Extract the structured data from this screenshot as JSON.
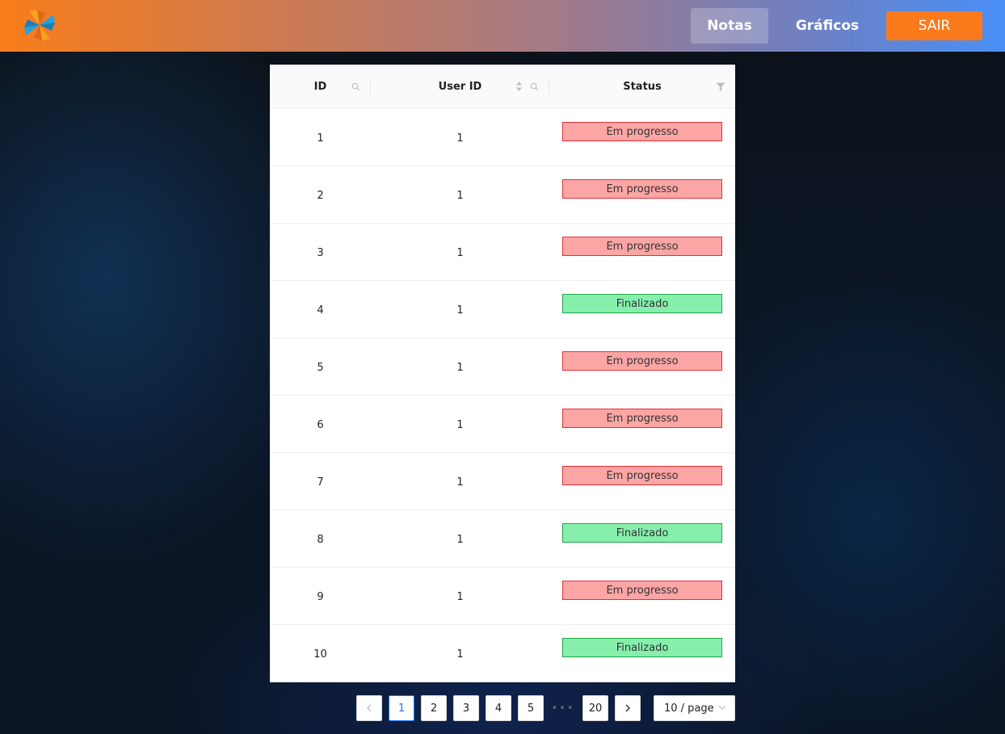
{
  "header": {
    "logo_icon": "pinwheel-logo-icon",
    "nav": {
      "notas": "Notas",
      "graficos": "Gráficos",
      "sair": "SAIR"
    },
    "colors": {
      "gradient_start": "#f97d1a",
      "gradient_end": "#4a8ff5",
      "sair_bg": "#fa7a1c"
    }
  },
  "table": {
    "columns": {
      "id": "ID",
      "user_id": "User ID",
      "status": "Status"
    },
    "column_icons": {
      "id": "search-icon",
      "user_id": [
        "sort-icon",
        "search-icon"
      ],
      "status": "filter-icon"
    },
    "rows": [
      {
        "id": "1",
        "user_id": "1",
        "status": "Em progresso"
      },
      {
        "id": "2",
        "user_id": "1",
        "status": "Em progresso"
      },
      {
        "id": "3",
        "user_id": "1",
        "status": "Em progresso"
      },
      {
        "id": "4",
        "user_id": "1",
        "status": "Finalizado"
      },
      {
        "id": "5",
        "user_id": "1",
        "status": "Em progresso"
      },
      {
        "id": "6",
        "user_id": "1",
        "status": "Em progresso"
      },
      {
        "id": "7",
        "user_id": "1",
        "status": "Em progresso"
      },
      {
        "id": "8",
        "user_id": "1",
        "status": "Finalizado"
      },
      {
        "id": "9",
        "user_id": "1",
        "status": "Em progresso"
      },
      {
        "id": "10",
        "user_id": "1",
        "status": "Finalizado"
      }
    ],
    "status_colors": {
      "Em progresso": {
        "bg": "#fca5a5",
        "border": "#e0303a"
      },
      "Finalizado": {
        "bg": "#86efac",
        "border": "#22a34a"
      }
    }
  },
  "pagination": {
    "pages": [
      "1",
      "2",
      "3",
      "4",
      "5"
    ],
    "ellipsis": "•••",
    "last_page": "20",
    "current_page": "1",
    "page_size": "10 / page",
    "prev_icon": "chevron-left-icon",
    "next_icon": "chevron-right-icon"
  }
}
